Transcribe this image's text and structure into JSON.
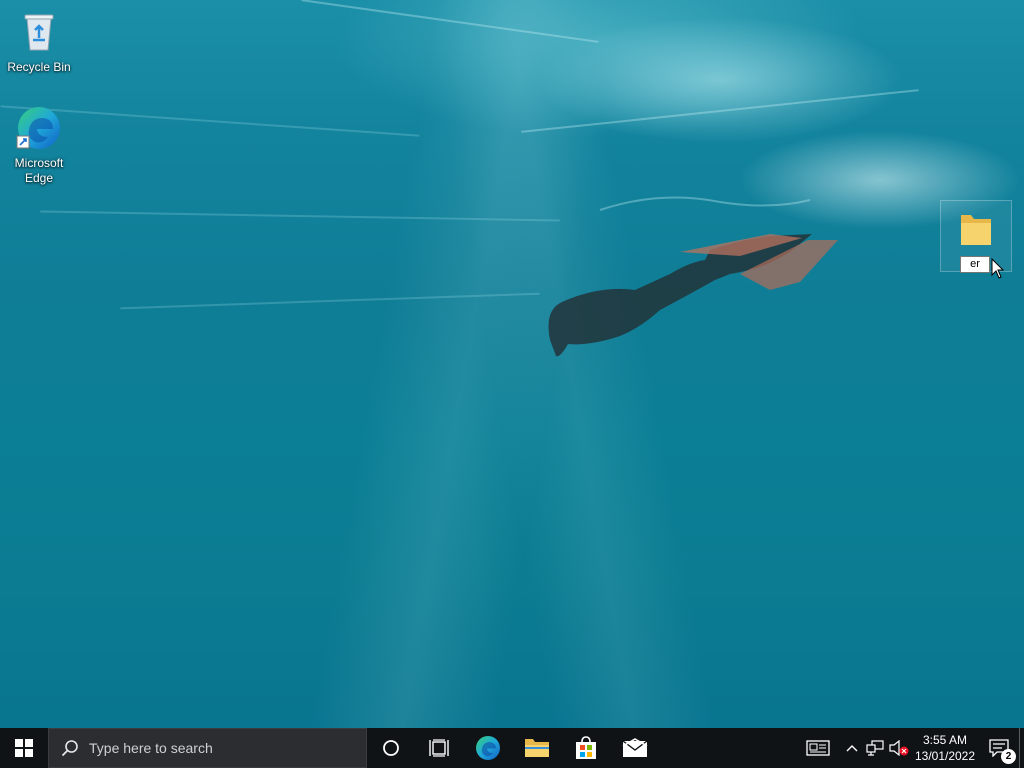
{
  "desktop": {
    "icons": [
      {
        "label": "Recycle Bin",
        "icon": "recycle-bin-icon"
      },
      {
        "label": "Microsoft Edge",
        "icon": "edge-icon"
      }
    ],
    "dragging": {
      "label": "er",
      "icon": "folder-icon"
    }
  },
  "taskbar": {
    "start_icon": "windows-logo-icon",
    "search_placeholder": "Type here to search",
    "pinned": [
      {
        "name": "Cortana",
        "icon": "cortana-icon"
      },
      {
        "name": "Task View",
        "icon": "task-view-icon"
      },
      {
        "name": "Microsoft Edge",
        "icon": "edge-icon"
      },
      {
        "name": "File Explorer",
        "icon": "folder-icon"
      },
      {
        "name": "Microsoft Store",
        "icon": "store-icon"
      },
      {
        "name": "Mail",
        "icon": "mail-icon"
      }
    ],
    "tray": {
      "news_icon": "news-icon",
      "chevron_icon": "chevron-up-icon",
      "network_icon": "network-icon",
      "volume_icon": "volume-muted-icon",
      "time": "3:55 AM",
      "date": "13/01/2022",
      "notification_count": "2"
    }
  },
  "colors": {
    "taskbar_bg": "#0f1316",
    "search_bg": "#2b2d31",
    "water": "#0f7d96"
  }
}
